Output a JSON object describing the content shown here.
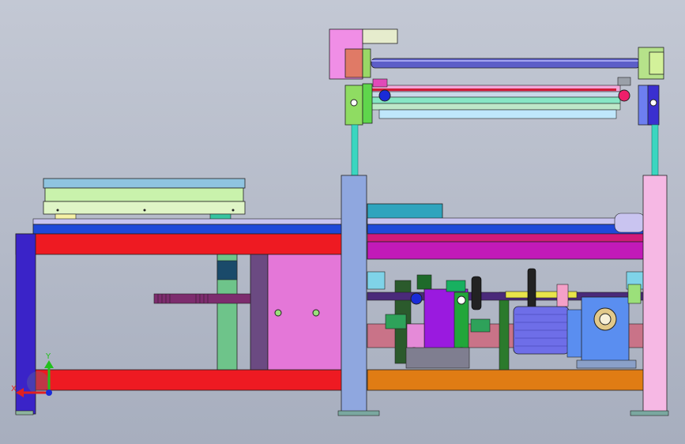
{
  "viewport": {
    "background_top": "#c3c8d4",
    "background_bottom": "#a7aebe"
  },
  "triad": {
    "x_label": "X",
    "y_label": "Y",
    "x_color": "#e02020",
    "y_color": "#22c01c",
    "z_color": "#1a2bd8"
  },
  "colors": {
    "frame_red": "#ee1a22",
    "frame_blue": "#1f49d8",
    "frame_orange": "#e07c14",
    "frame_magenta": "#c21ab8",
    "left_post": "#3a23c8",
    "pink_post": "#f6b8e4",
    "slate_post": "#8fa7df",
    "cyan_rod": "#3ad6c0",
    "pale_green": "#c9f2ac",
    "light_blue": "#8fc4e0",
    "purple_block": "#9a1adf",
    "motor_blue": "#6e6ee8",
    "gearbox": "#5a8ef0",
    "panel_pink": "#e477d8"
  }
}
